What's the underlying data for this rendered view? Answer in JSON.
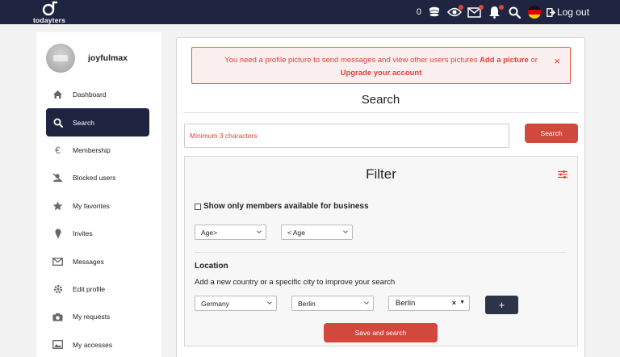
{
  "brand": {
    "name": "todayters"
  },
  "topbar": {
    "coin_count": "0",
    "logout_label": "Log out",
    "icons": [
      "coins-icon",
      "eye-icon",
      "mail-icon",
      "bell-icon",
      "search-icon",
      "german-flag-icon",
      "logout-icon"
    ]
  },
  "sidebar": {
    "username": "joyfulmax",
    "items": [
      {
        "label": "Dashboard",
        "icon": "home-icon"
      },
      {
        "label": "Search",
        "icon": "search-icon",
        "active": true
      },
      {
        "label": "Membership",
        "icon": "euro-icon"
      },
      {
        "label": "Blocked users",
        "icon": "blocked-user-icon"
      },
      {
        "label": "My favorites",
        "icon": "star-icon"
      },
      {
        "label": "Invites",
        "icon": "ice-cream-icon"
      },
      {
        "label": "Messages",
        "icon": "envelope-icon"
      },
      {
        "label": "Edit profile",
        "icon": "gear-icon"
      },
      {
        "label": "My requests",
        "icon": "camera-icon"
      },
      {
        "label": "My accesses",
        "icon": "images-icon"
      }
    ]
  },
  "alert": {
    "text": "You need a profile picture to send messages and view other users pictures",
    "link1": "Add a picture",
    "or": "or",
    "link2": "Upgrade your account",
    "close": "×"
  },
  "search": {
    "title": "Search",
    "placeholder": "Minimum 3 characters",
    "button": "Search"
  },
  "filter": {
    "title": "Filter",
    "business_label": "Show only members available for business",
    "age_min": "Age>",
    "age_max": "< Age",
    "location_title": "Location",
    "location_sub": "Add a new country or a specific city to improve your search",
    "country": "Germany",
    "city": "Berlin",
    "selected_city": "Berlin",
    "clear": "×",
    "add_button": "+",
    "save_button": "Save and search"
  },
  "colors": {
    "navy": "#1f2540",
    "accent": "#d3483d",
    "alert_text": "#e0433a"
  }
}
